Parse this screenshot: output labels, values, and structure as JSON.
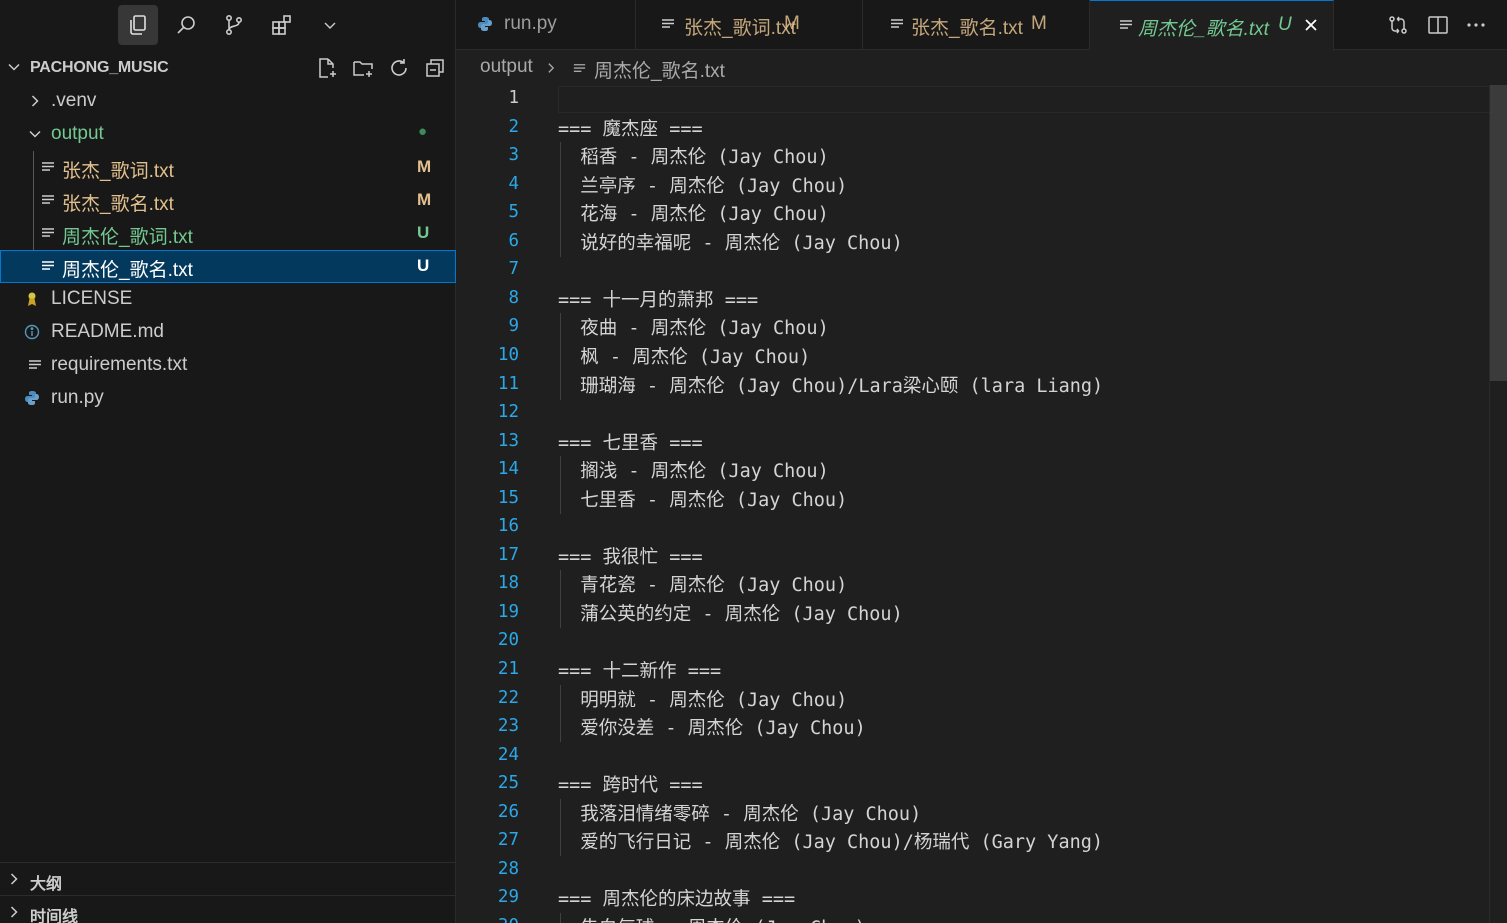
{
  "explorer": {
    "title": "PACHONG_MUSIC",
    "items": [
      {
        "label": ".venv",
        "badge": ""
      },
      {
        "label": "output",
        "badge": "●"
      },
      {
        "label": "张杰_歌词.txt",
        "badge": "M"
      },
      {
        "label": "张杰_歌名.txt",
        "badge": "M"
      },
      {
        "label": "周杰伦_歌词.txt",
        "badge": "U"
      },
      {
        "label": "周杰伦_歌名.txt",
        "badge": "U"
      },
      {
        "label": "LICENSE",
        "badge": ""
      },
      {
        "label": "README.md",
        "badge": ""
      },
      {
        "label": "requirements.txt",
        "badge": ""
      },
      {
        "label": "run.py",
        "badge": ""
      }
    ]
  },
  "panels": {
    "outline": "大纲",
    "timeline": "时间线"
  },
  "tabs": [
    {
      "label": "run.py",
      "status": ""
    },
    {
      "label": "张杰_歌词.txt",
      "status": "M"
    },
    {
      "label": "张杰_歌名.txt",
      "status": "M"
    },
    {
      "label": "周杰伦_歌名.txt",
      "status": "U"
    }
  ],
  "breadcrumb": {
    "folder": "output",
    "file": "周杰伦_歌名.txt"
  },
  "colors": {
    "modified": "#e2c08d",
    "untracked": "#73c991",
    "accent": "#0078d4",
    "line_numbers": "#2aa8e8"
  },
  "editor": {
    "lines": [
      "",
      "=== 魔杰座 ===",
      "  稻香 - 周杰伦 (Jay Chou)",
      "  兰亭序 - 周杰伦 (Jay Chou)",
      "  花海 - 周杰伦 (Jay Chou)",
      "  说好的幸福呢 - 周杰伦 (Jay Chou)",
      "",
      "=== 十一月的萧邦 ===",
      "  夜曲 - 周杰伦 (Jay Chou)",
      "  枫 - 周杰伦 (Jay Chou)",
      "  珊瑚海 - 周杰伦 (Jay Chou)/Lara梁心颐 (lara Liang)",
      "",
      "=== 七里香 ===",
      "  搁浅 - 周杰伦 (Jay Chou)",
      "  七里香 - 周杰伦 (Jay Chou)",
      "",
      "=== 我很忙 ===",
      "  青花瓷 - 周杰伦 (Jay Chou)",
      "  蒲公英的约定 - 周杰伦 (Jay Chou)",
      "",
      "=== 十二新作 ===",
      "  明明就 - 周杰伦 (Jay Chou)",
      "  爱你没差 - 周杰伦 (Jay Chou)",
      "",
      "=== 跨时代 ===",
      "  我落泪情绪零碎 - 周杰伦 (Jay Chou)",
      "  爱的飞行日记 - 周杰伦 (Jay Chou)/杨瑞代 (Gary Yang)",
      "",
      "=== 周杰伦的床边故事 ===",
      "  告白气球 - 周杰伦 (Jay Chou)"
    ]
  }
}
